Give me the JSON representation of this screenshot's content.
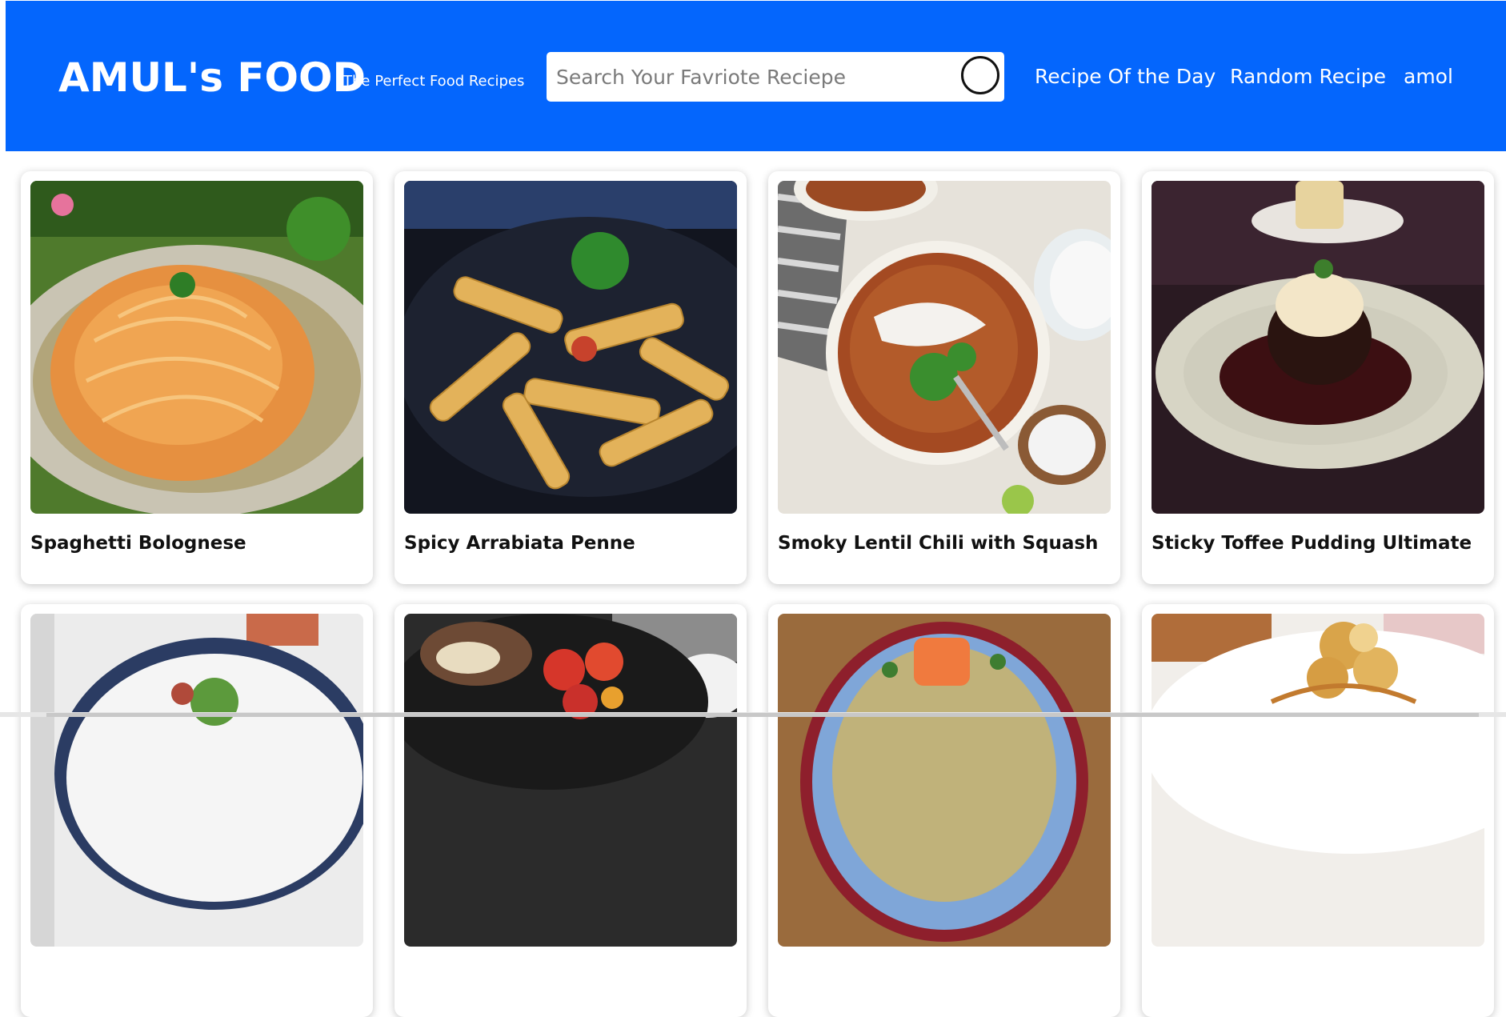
{
  "header": {
    "brand": "AMUL's FOOD",
    "tagline": "The Perfect Food Recipes",
    "search": {
      "placeholder": "Search Your Favriote Reciepe",
      "value": "",
      "button_icon": "circle-search-icon"
    },
    "nav": [
      {
        "label": "Recipe Of the Day"
      },
      {
        "label": "Random Recipe"
      },
      {
        "label": "amol"
      }
    ],
    "accent_color": "#0466fd"
  },
  "recipes": [
    {
      "title": "Spaghetti Bolognese",
      "image": "spaghetti-image"
    },
    {
      "title": "Spicy Arrabiata Penne",
      "image": "penne-image"
    },
    {
      "title": "Smoky Lentil Chili with Squash",
      "image": "lentil-chili-image"
    },
    {
      "title": "Sticky Toffee Pudding Ultimate",
      "image": "toffee-pudding-image"
    },
    {
      "title": "",
      "image": "salad-image"
    },
    {
      "title": "",
      "image": "roasted-veg-image"
    },
    {
      "title": "",
      "image": "salmon-rice-image"
    },
    {
      "title": "",
      "image": "profiterole-image"
    }
  ]
}
